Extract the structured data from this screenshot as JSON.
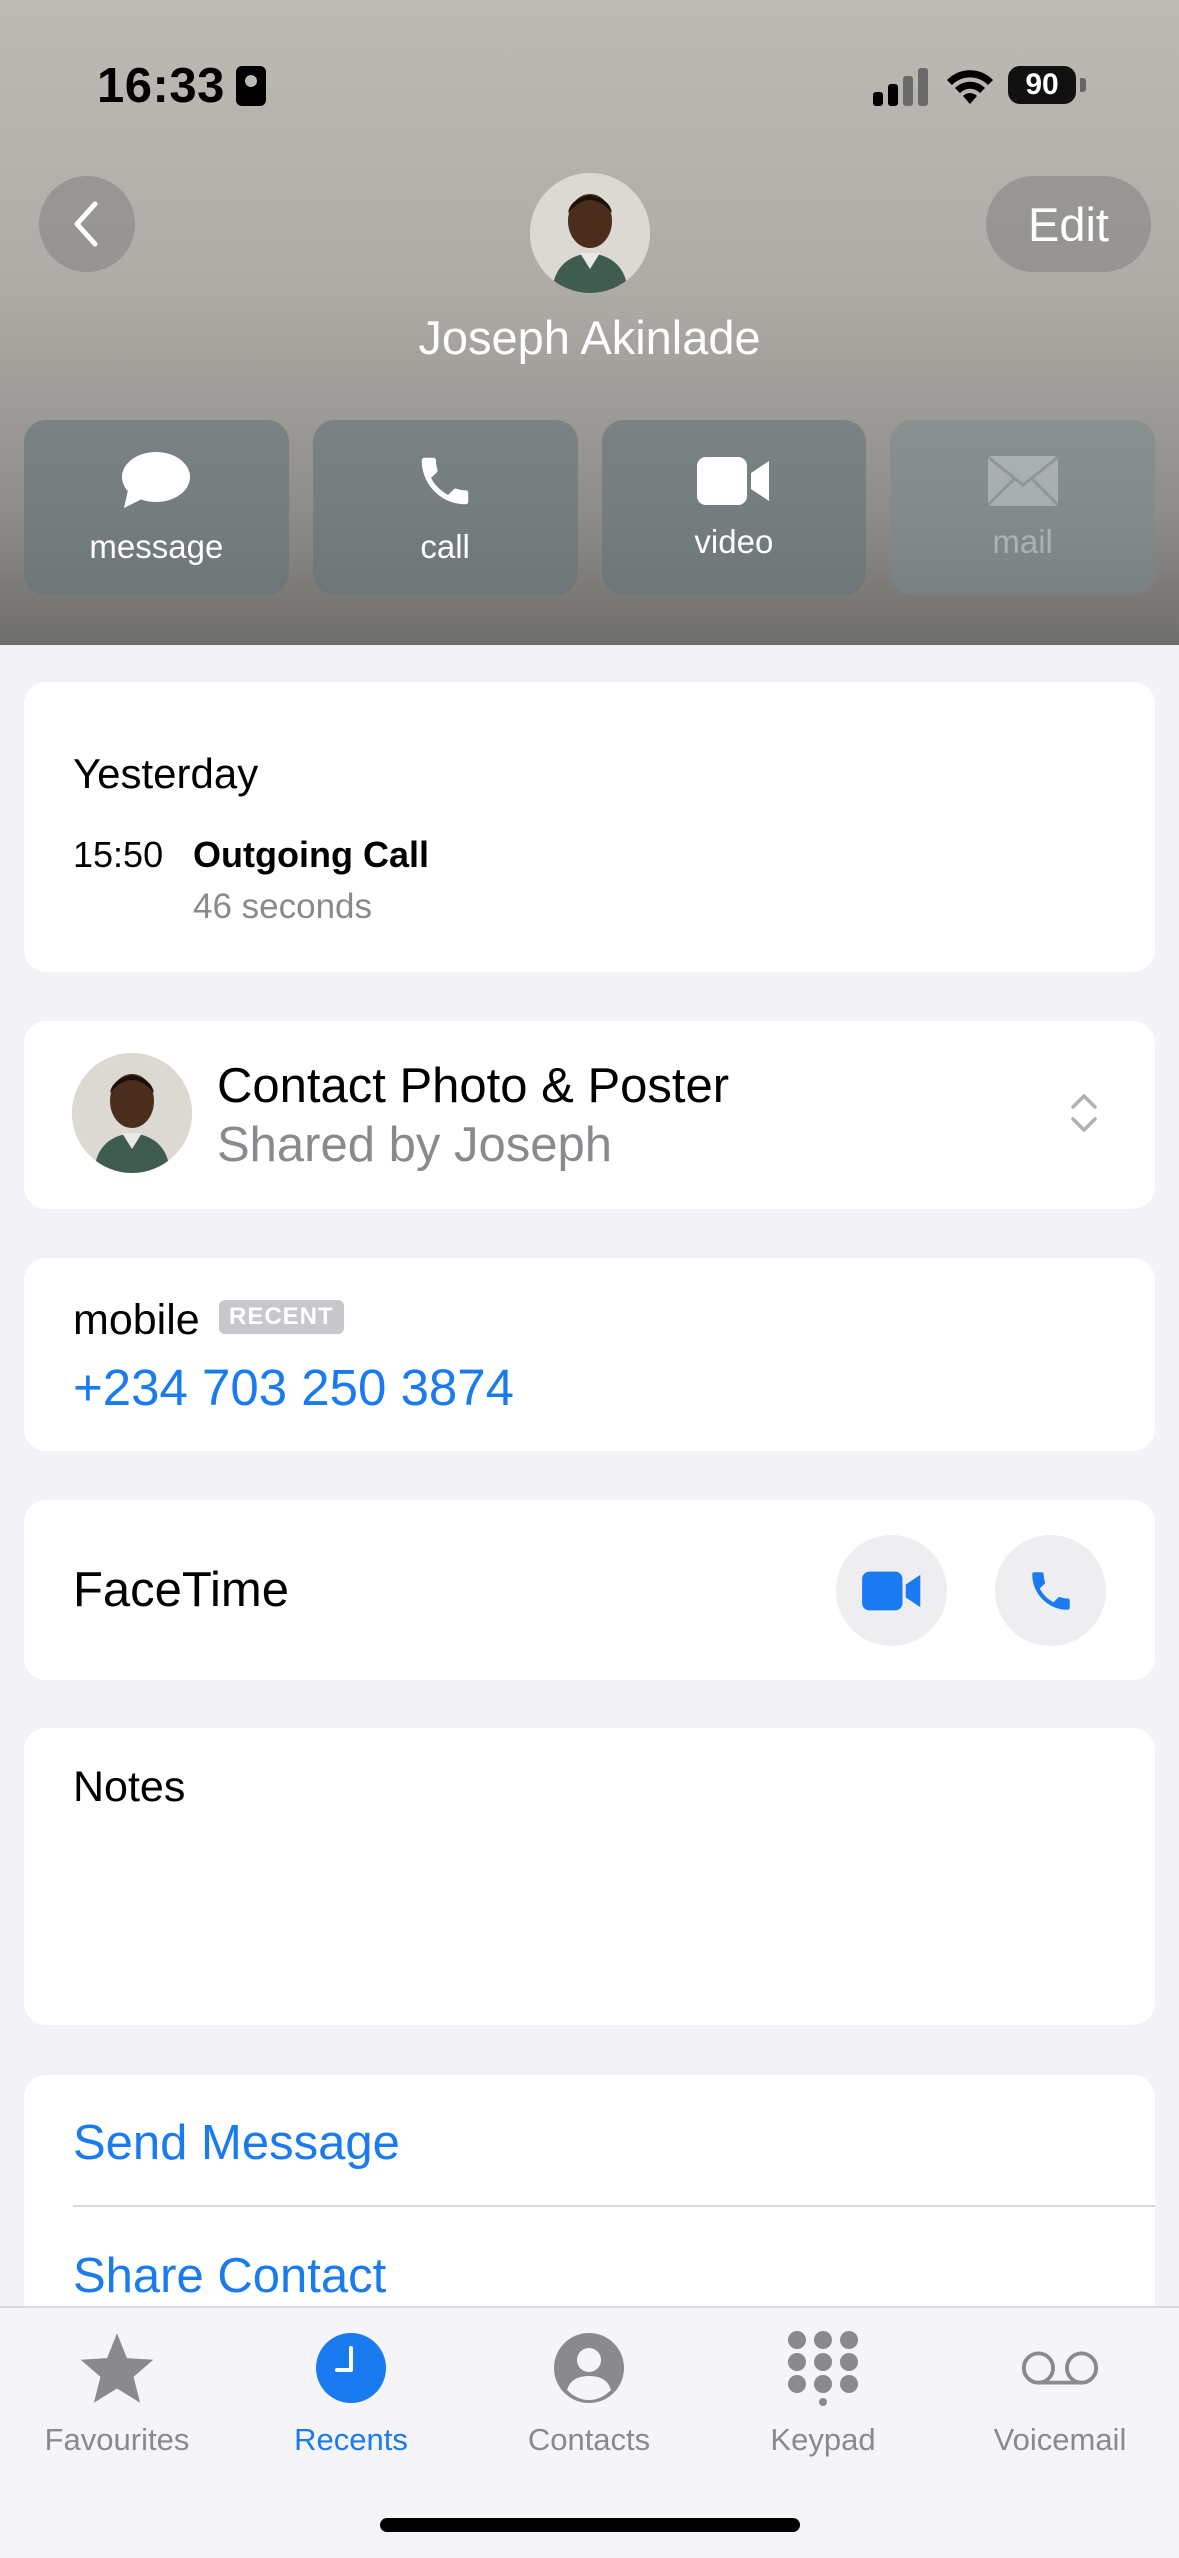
{
  "status_bar": {
    "time": "16:33",
    "battery": "90"
  },
  "header": {
    "edit_label": "Edit",
    "contact_name": "Joseph Akinlade",
    "actions": [
      {
        "label": "message",
        "icon": "message-bubble-icon",
        "enabled": true
      },
      {
        "label": "call",
        "icon": "phone-icon",
        "enabled": true
      },
      {
        "label": "video",
        "icon": "video-camera-icon",
        "enabled": true
      },
      {
        "label": "mail",
        "icon": "envelope-icon",
        "enabled": false
      }
    ]
  },
  "recent_call": {
    "day": "Yesterday",
    "time": "15:50",
    "type": "Outgoing Call",
    "duration": "46 seconds"
  },
  "contact_photo": {
    "title": "Contact Photo & Poster",
    "subtitle": "Shared by Joseph"
  },
  "mobile": {
    "label": "mobile",
    "badge": "RECENT",
    "number": "+234 703 250 3874"
  },
  "facetime": {
    "label": "FaceTime"
  },
  "notes": {
    "label": "Notes"
  },
  "links": {
    "send_message": "Send Message",
    "share_contact": "Share Contact"
  },
  "tabbar": {
    "tabs": [
      {
        "label": "Favourites",
        "icon": "star-icon"
      },
      {
        "label": "Recents",
        "icon": "clock-icon",
        "active": true
      },
      {
        "label": "Contacts",
        "icon": "person-circle-icon"
      },
      {
        "label": "Keypad",
        "icon": "keypad-icon"
      },
      {
        "label": "Voicemail",
        "icon": "voicemail-icon"
      }
    ]
  },
  "colors": {
    "accent": "#1a7bf0",
    "secondary_text": "#8a8a8e",
    "background": "#f2f2f7"
  }
}
